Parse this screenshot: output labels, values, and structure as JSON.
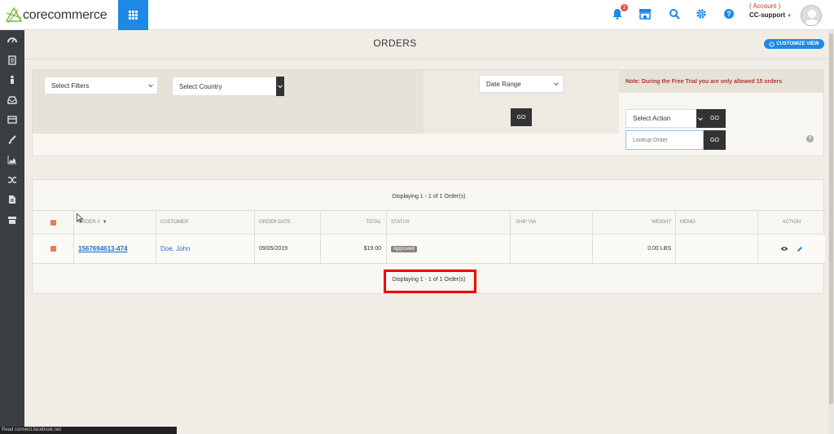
{
  "header": {
    "logo_text": "corecommerce",
    "account_label": "( Account )",
    "account_name": "CC-support",
    "notification_count": "3"
  },
  "page": {
    "title": "ORDERS",
    "customize_label": "CUSTOMIZE VIEW"
  },
  "filters": {
    "select_filters": "Select Filters",
    "select_country": "Select Country",
    "date_range": "Date Range",
    "go_label": "GO",
    "note": "Note: During the Free Trial you are only allowed 15 orders",
    "select_action": "Select Action",
    "lookup_placeholder": "Lookup Order",
    "help": "?"
  },
  "table": {
    "displaying_top": "Displaying 1 - 1 of 1 Order(s)",
    "displaying_bottom": "Displaying 1 - 1 of 1 Order(s)",
    "columns": {
      "order": "ORDER #",
      "customer": "CUSTOMER",
      "order_date": "ORDER DATE",
      "total": "TOTAL",
      "status": "STATUS",
      "ship_via": "SHIP VIA",
      "weight": "WEIGHT",
      "memo": "MEMO",
      "action": "ACTION"
    },
    "rows": [
      {
        "order_number": "1567694613-474",
        "customer": "Doe, John",
        "order_date": "09/05/2019",
        "total": "$19.00",
        "status": "Approved",
        "ship_via": "",
        "weight": "0.00 LBS",
        "memo": ""
      }
    ]
  },
  "statusbar": {
    "text": "Read connect.facebook.net"
  },
  "colors": {
    "accent": "#1e88e5",
    "sidebar": "#3a3d42",
    "checkbox": "#e67e50",
    "highlight": "#e00000"
  }
}
